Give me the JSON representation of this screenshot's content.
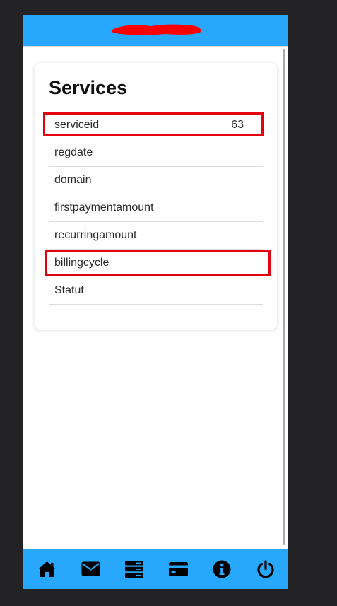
{
  "card": {
    "title": "Services",
    "fields": [
      {
        "label": "serviceid",
        "value": "63"
      },
      {
        "label": "regdate",
        "value": ""
      },
      {
        "label": "domain",
        "value": ""
      },
      {
        "label": "firstpaymentamount",
        "value": ""
      },
      {
        "label": "recurringamount",
        "value": ""
      },
      {
        "label": "billingcycle",
        "value": ""
      },
      {
        "label": "Statut",
        "value": ""
      }
    ]
  },
  "bottom_nav": {
    "items": [
      {
        "icon": "home-icon"
      },
      {
        "icon": "envelope-icon"
      },
      {
        "icon": "server-icon"
      },
      {
        "icon": "credit-card-icon"
      },
      {
        "icon": "info-icon"
      },
      {
        "icon": "power-icon"
      }
    ]
  },
  "colors": {
    "accent": "#27a8fc",
    "highlight": "#e3000f",
    "redaction": "#ff0000",
    "background": "#232325"
  }
}
